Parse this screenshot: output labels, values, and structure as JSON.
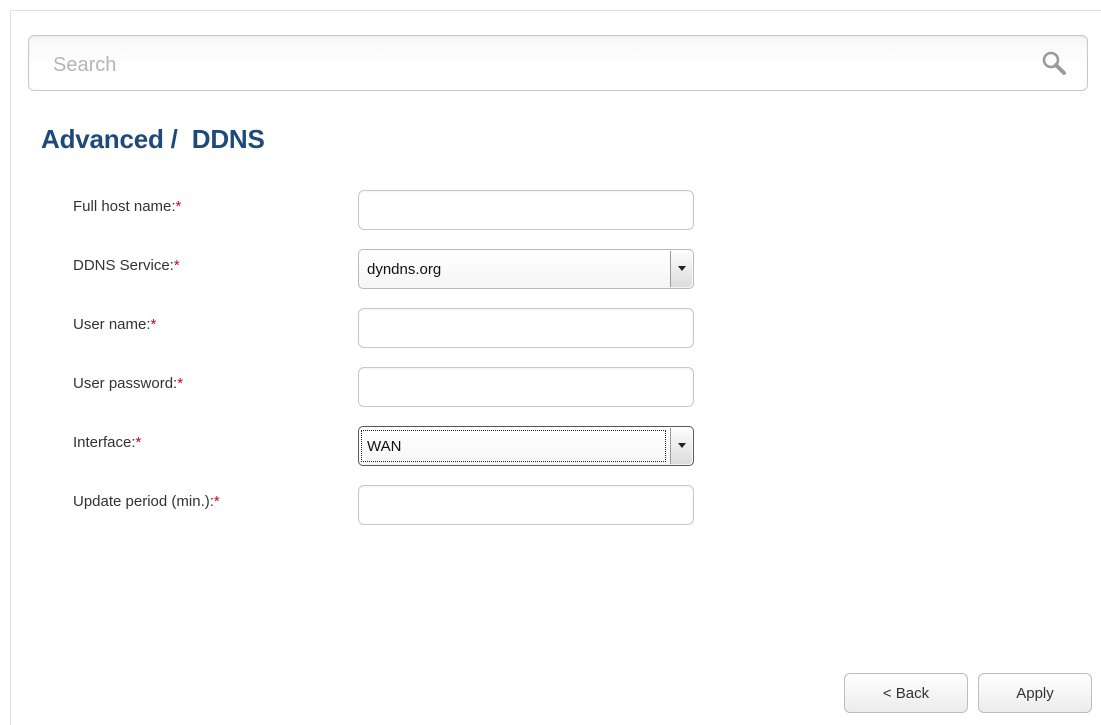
{
  "search": {
    "placeholder": "Search"
  },
  "page": {
    "title": "Advanced /  DDNS"
  },
  "form": {
    "required_marker": "*",
    "fields": [
      {
        "label": "Full host name:",
        "type": "text",
        "value": ""
      },
      {
        "label": "DDNS Service:",
        "type": "select",
        "value": "dyndns.org"
      },
      {
        "label": "User name:",
        "type": "text",
        "value": ""
      },
      {
        "label": "User password:",
        "type": "password",
        "value": ""
      },
      {
        "label": "Interface:",
        "type": "select",
        "value": "WAN",
        "focused": true
      },
      {
        "label": "Update period (min.):",
        "type": "text",
        "value": ""
      }
    ]
  },
  "buttons": {
    "back": "< Back",
    "apply": "Apply"
  },
  "colors": {
    "title": "#1d4a7a",
    "required": "#d0021b"
  },
  "icons": {
    "search": "search-icon",
    "dropdown": "chevron-down-icon"
  }
}
